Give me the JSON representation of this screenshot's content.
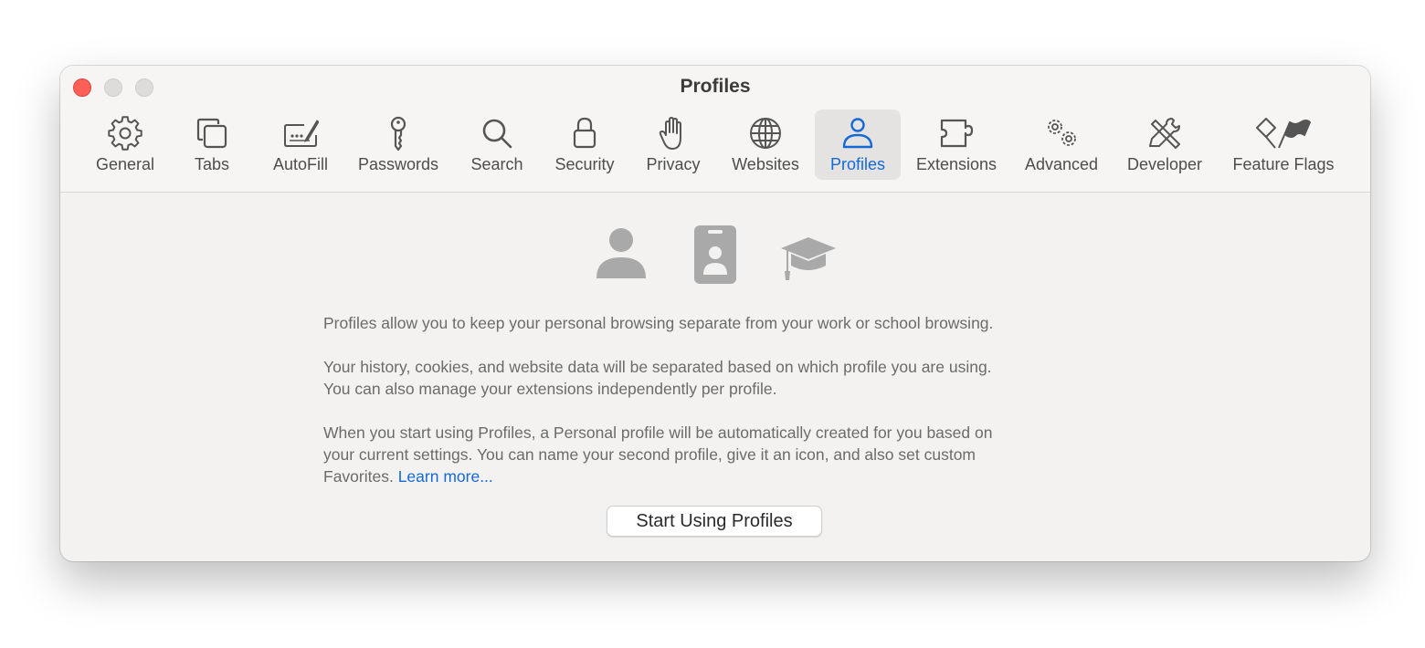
{
  "window": {
    "title": "Profiles",
    "traffic_lights": [
      "close",
      "minimize",
      "zoom"
    ]
  },
  "toolbar": {
    "active": "Profiles",
    "items": [
      {
        "label": "General",
        "icon": "gear-icon"
      },
      {
        "label": "Tabs",
        "icon": "tabs-icon"
      },
      {
        "label": "AutoFill",
        "icon": "autofill-icon"
      },
      {
        "label": "Passwords",
        "icon": "key-icon"
      },
      {
        "label": "Search",
        "icon": "magnifier-icon"
      },
      {
        "label": "Security",
        "icon": "lock-icon"
      },
      {
        "label": "Privacy",
        "icon": "hand-icon"
      },
      {
        "label": "Websites",
        "icon": "globe-icon"
      },
      {
        "label": "Profiles",
        "icon": "person-icon"
      },
      {
        "label": "Extensions",
        "icon": "puzzle-icon"
      },
      {
        "label": "Advanced",
        "icon": "gears-icon"
      },
      {
        "label": "Developer",
        "icon": "tools-icon"
      },
      {
        "label": "Feature Flags",
        "icon": "flags-icon"
      }
    ]
  },
  "content": {
    "hero_icons": [
      "person-silhouette-icon",
      "id-badge-icon",
      "graduation-cap-icon"
    ],
    "paragraph_1": "Profiles allow you to keep your personal browsing separate from your work or school browsing.",
    "paragraph_2_line_1": "Your history, cookies, and website data will be separated based on which profile you are using.",
    "paragraph_2_line_2": "You can also manage your extensions independently per profile.",
    "paragraph_3_line_1": "When you start using Profiles, a Personal profile will be automatically created for you based on",
    "paragraph_3_line_2": "your current settings. You can name your second profile, give it an icon, and also set custom",
    "paragraph_3_line_3": "Favorites.",
    "learn_more": "Learn more...",
    "start_button": "Start Using Profiles"
  },
  "colors": {
    "accent": "#1469d4",
    "close": "#fe5f57",
    "inactive_light": "#dddcdb",
    "hero_icon": "#a9a9a9"
  }
}
